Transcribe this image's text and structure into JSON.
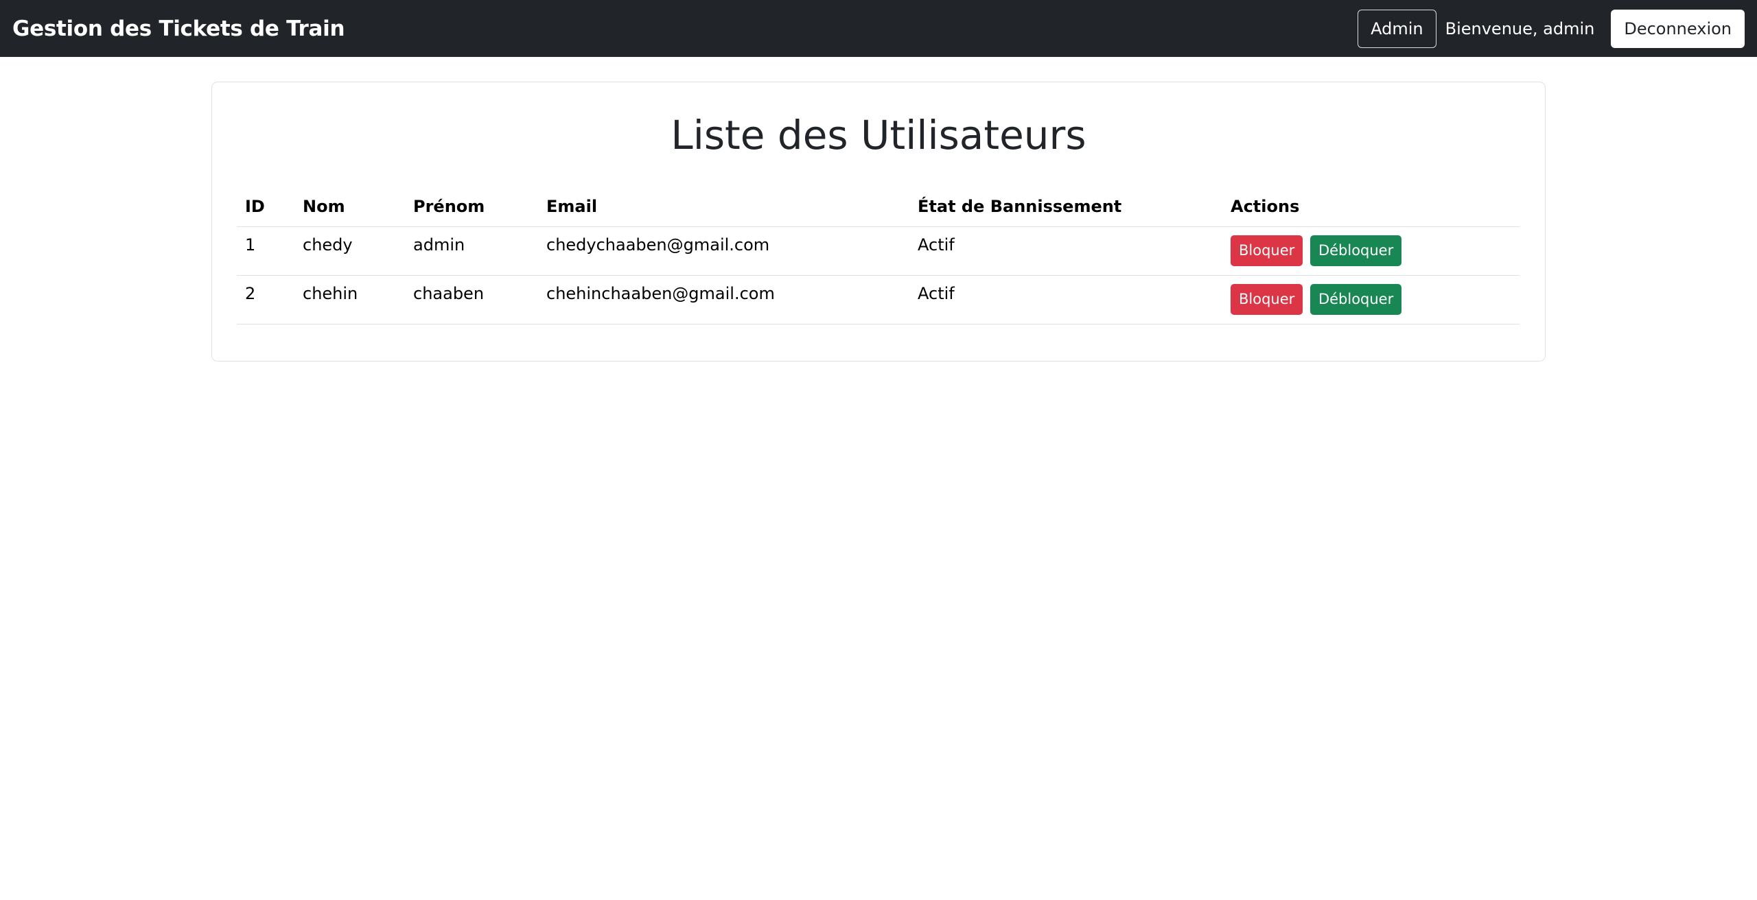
{
  "navbar": {
    "brand": "Gestion des Tickets de Train",
    "admin_button": "Admin",
    "welcome_text": "Bienvenue, admin",
    "logout_button": "Deconnexion"
  },
  "main": {
    "title": "Liste des Utilisateurs",
    "table": {
      "headers": [
        "ID",
        "Nom",
        "Prénom",
        "Email",
        "État de Bannissement",
        "Actions"
      ],
      "rows": [
        {
          "id": "1",
          "nom": "chedy",
          "prenom": "admin",
          "email": "chedychaaben@gmail.com",
          "etat": "Actif",
          "block_label": "Bloquer",
          "unblock_label": "Débloquer"
        },
        {
          "id": "2",
          "nom": "chehin",
          "prenom": "chaaben",
          "email": "chehinchaaben@gmail.com",
          "etat": "Actif",
          "block_label": "Bloquer",
          "unblock_label": "Débloquer"
        }
      ]
    }
  },
  "colors": {
    "navbar_bg": "#212529",
    "danger": "#dc3545",
    "success": "#198754",
    "border": "#dee2e6"
  }
}
